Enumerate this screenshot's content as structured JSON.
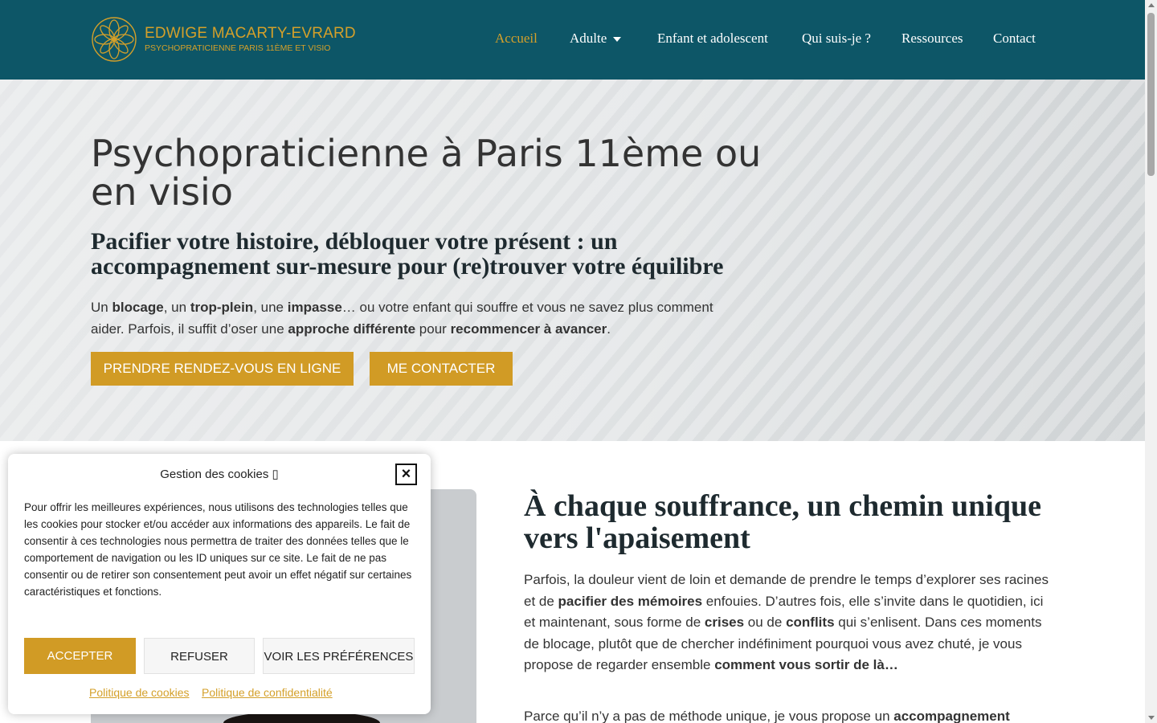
{
  "header": {
    "logo_name": "EDWIGE MACARTY-EVRARD",
    "logo_tagline": "PSYCHOPRATICIENNE PARIS 11ÈME ET VISIO",
    "nav": {
      "home": "Accueil",
      "adult": "Adulte",
      "child": "Enfant et adolescent",
      "about": "Qui suis-je ?",
      "resources": "Ressources",
      "contact": "Contact"
    }
  },
  "hero": {
    "title": "Psychopraticienne à Paris 11ème ou en visio",
    "subtitle": "Pacifier votre histoire, débloquer votre présent : un accompagnement sur-mesure pour (re)trouver votre équilibre",
    "text": {
      "t1": "Un ",
      "b1": "blocage",
      "t2": ", un ",
      "b2": "trop-plein",
      "t3": ", une ",
      "b3": "impasse",
      "t4": "… ou votre enfant qui souffre et vous ne savez plus comment aider. Parfois, il suffit d’oser une ",
      "b4": "approche différente",
      "t5": " pour ",
      "b5": "recommencer à avancer",
      "t6": "."
    },
    "buttons": {
      "book": "PRENDRE RENDEZ-VOUS EN LIGNE",
      "contact": "ME CONTACTER"
    }
  },
  "section": {
    "title": "À chaque souffrance, un chemin unique vers l'apaisement",
    "p1": {
      "t1": "Parfois, la douleur vient de loin et demande de prendre le temps d’explorer ses racines et de ",
      "b1": "pacifier des mémoires",
      "t2": " enfouies. D’autres fois, elle s’invite dans le quotidien, ici et maintenant, sous forme de ",
      "b2": "crises",
      "t3": " ou de ",
      "b3": "conflits",
      "t4": " qui s’enlisent. Dans ces moments de blocage, plutôt que de chercher indéfiniment pourquoi vous avez chuté, je vous propose de regarder ensemble ",
      "b4": "comment vous sortir de là…"
    },
    "p2": {
      "t1": "Parce qu’il n’y a pas de méthode unique, je vous propose un ",
      "b1": "accompagnement"
    }
  },
  "cookie": {
    "title": "Gestion des cookies ▯",
    "close_symbol": "×",
    "text": "Pour offrir les meilleures expériences, nous utilisons des technologies telles que les cookies pour stocker et/ou accéder aux informations des appareils. Le fait de consentir à ces technologies nous permettra de traiter des données telles que le comportement de navigation ou les ID uniques sur ce site. Le fait de ne pas consentir ou de retirer son consentement peut avoir un effet négatif sur certaines caractéristiques et fonctions.",
    "accept": "ACCEPTER",
    "refuse": "REFUSER",
    "preferences": "VOIR LES PRÉFÉRENCES",
    "cookie_policy": "Politique de cookies",
    "privacy_policy": "Politique de confidentialité"
  },
  "colors": {
    "header_bg": "#0d5667",
    "accent_gold": "#d19b25",
    "text_dark": "#333333"
  }
}
